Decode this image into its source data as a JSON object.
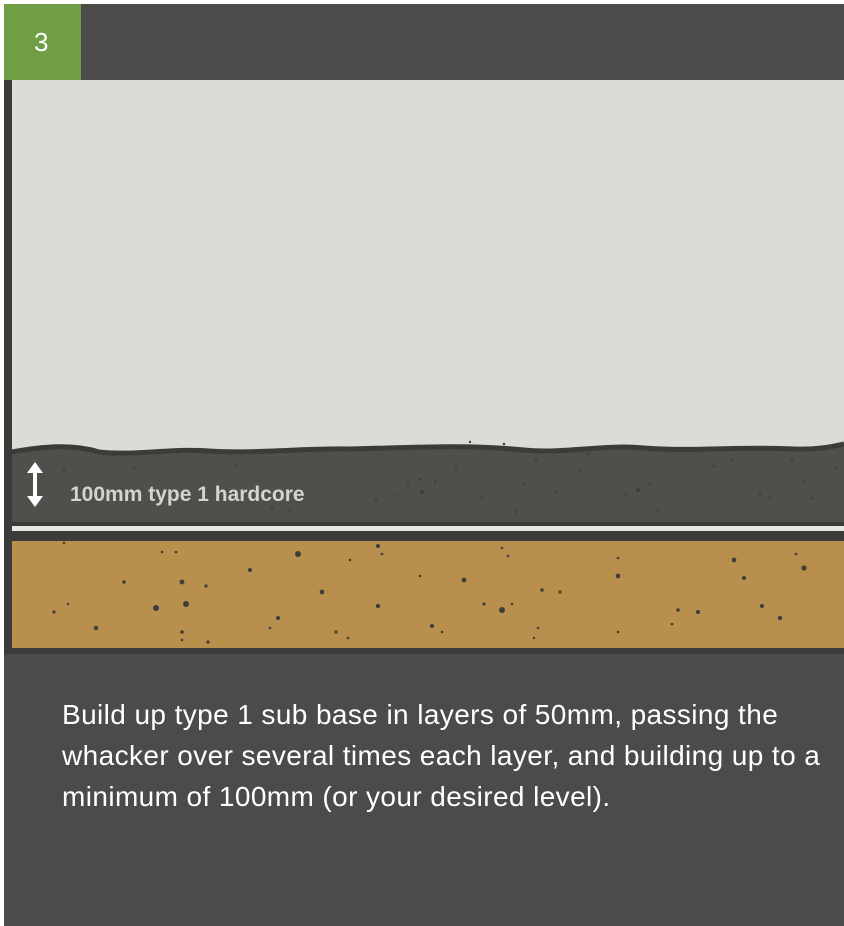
{
  "step": {
    "number": "3"
  },
  "diagram": {
    "layer_label": "100mm type 1 hardcore",
    "colors": {
      "sky": "#dcdcd7",
      "hardcore": "#4f504c",
      "sand": "#b88f4d",
      "separator": "#e8e8e4",
      "frame": "#3b3c39",
      "label": "#d4d4cf",
      "speck": "#3e3e3b"
    },
    "icons": [
      "double-arrow-vertical-icon"
    ]
  },
  "caption": {
    "text": "Build up type 1 sub base in layers of 50mm, passing the whacker over several times each layer, and building up to a minimum of 100mm (or your desired level)."
  }
}
